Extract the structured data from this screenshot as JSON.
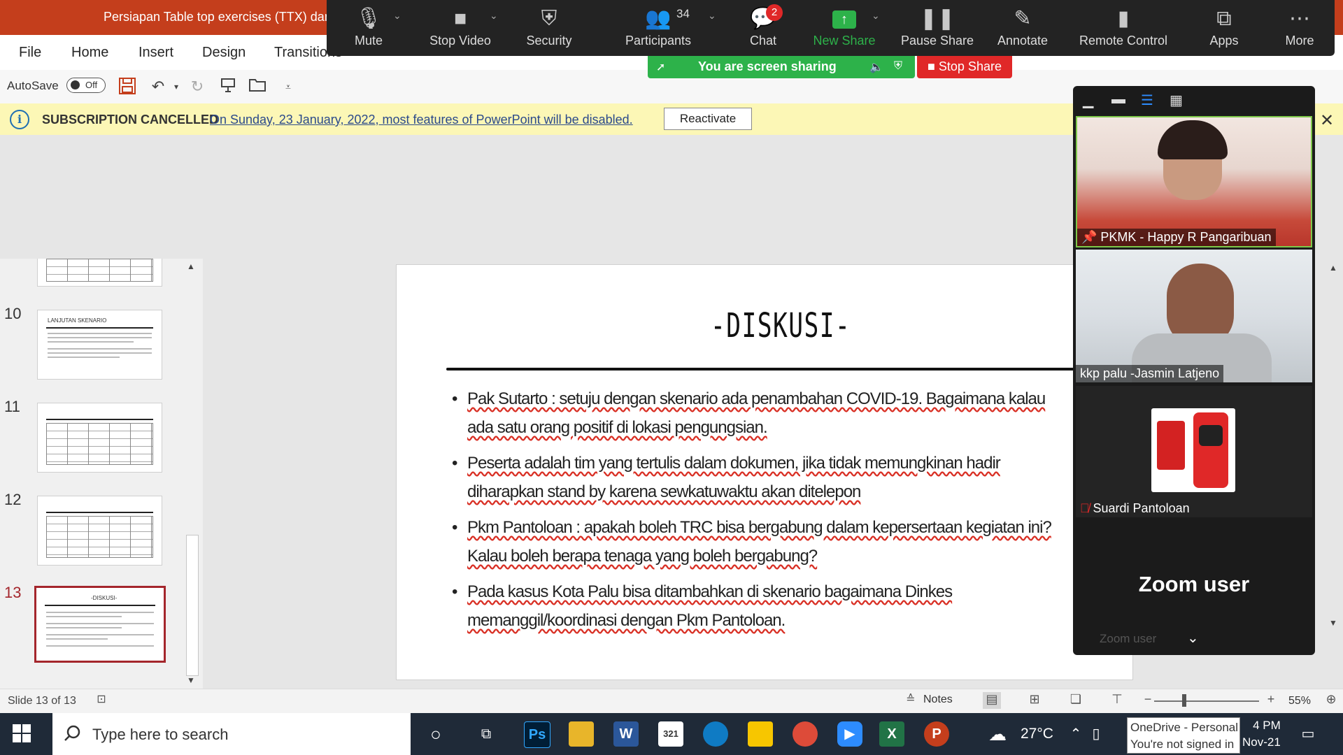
{
  "title_bar": {
    "doc_title": "Persiapan Table top exercises (TTX) dan s"
  },
  "ribbon": {
    "tabs": [
      "File",
      "Home",
      "Insert",
      "Design",
      "Transitions"
    ]
  },
  "quick_access": {
    "autosave_label": "AutoSave",
    "autosave_state": "Off"
  },
  "subscription": {
    "title": "SUBSCRIPTION CANCELLED",
    "message": "On Sunday, 23 January, 2022, most features of PowerPoint will be disabled.",
    "button": "Reactivate"
  },
  "thumbnails": [
    {
      "num": "10",
      "title": "LANJUTAN SKENARIO"
    },
    {
      "num": "11",
      "title": ""
    },
    {
      "num": "12",
      "title": ""
    },
    {
      "num": "13",
      "title": "-DISKUSI-"
    }
  ],
  "slide": {
    "title": "-DISKUSI-",
    "bullets": [
      "Pak Sutarto : setuju dengan skenario ada penambahan COVID-19. Bagaimana kalau ada satu orang positif di lokasi pengungsian.",
      "Peserta adalah tim yang tertulis dalam dokumen, jika tidak memungkinan hadir diharapkan stand by karena sewkatuwaktu akan ditelepon",
      "Pkm Pantoloan : apakah boleh TRC bisa bergabung dalam kepersertaan kegiatan ini? Kalau boleh berapa tenaga yang boleh bergabung?",
      "Pada kasus Kota Palu bisa ditambahkan di skenario bagaimana Dinkes memanggil/koordinasi dengan Pkm Pantoloan."
    ]
  },
  "status_bar": {
    "slide_count": "Slide 13 of 13",
    "notes": "Notes",
    "zoom": "55%"
  },
  "zoom_toolbar": {
    "buttons": [
      {
        "label": "Mute",
        "icon": "microphone-icon"
      },
      {
        "label": "Stop Video",
        "icon": "camera-icon"
      },
      {
        "label": "Security",
        "icon": "shield-icon"
      },
      {
        "label": "Participants",
        "icon": "people-icon"
      },
      {
        "label": "Chat",
        "icon": "chat-icon"
      },
      {
        "label": "New Share",
        "icon": "share-icon"
      },
      {
        "label": "Pause Share",
        "icon": "pause-icon"
      },
      {
        "label": "Annotate",
        "icon": "pen-icon"
      },
      {
        "label": "Remote Control",
        "icon": "mouse-icon"
      },
      {
        "label": "Apps",
        "icon": "apps-icon"
      },
      {
        "label": "More",
        "icon": "more-icon"
      }
    ],
    "participants_count": "34",
    "chat_badge": "2",
    "share_banner": "You are screen sharing",
    "stop_share": "Stop Share",
    "accent_green": "#2db24a",
    "accent_red": "#e02828"
  },
  "zoom_panel": {
    "participants": [
      {
        "name": "PKMK - Happy R Pangaribuan"
      },
      {
        "name": "kkp palu -Jasmin Latjeno"
      },
      {
        "name": "Suardi Pantoloan"
      }
    ],
    "zoom_user_big": "Zoom user",
    "zoom_user_small": "Zoom user"
  },
  "taskbar": {
    "search_placeholder": "Type here to search",
    "temperature": "27°C",
    "onedrive_line1": "OneDrive - Personal",
    "onedrive_line2": "You're not signed in",
    "clock_time": "4 PM",
    "clock_date": "Nov-21"
  }
}
